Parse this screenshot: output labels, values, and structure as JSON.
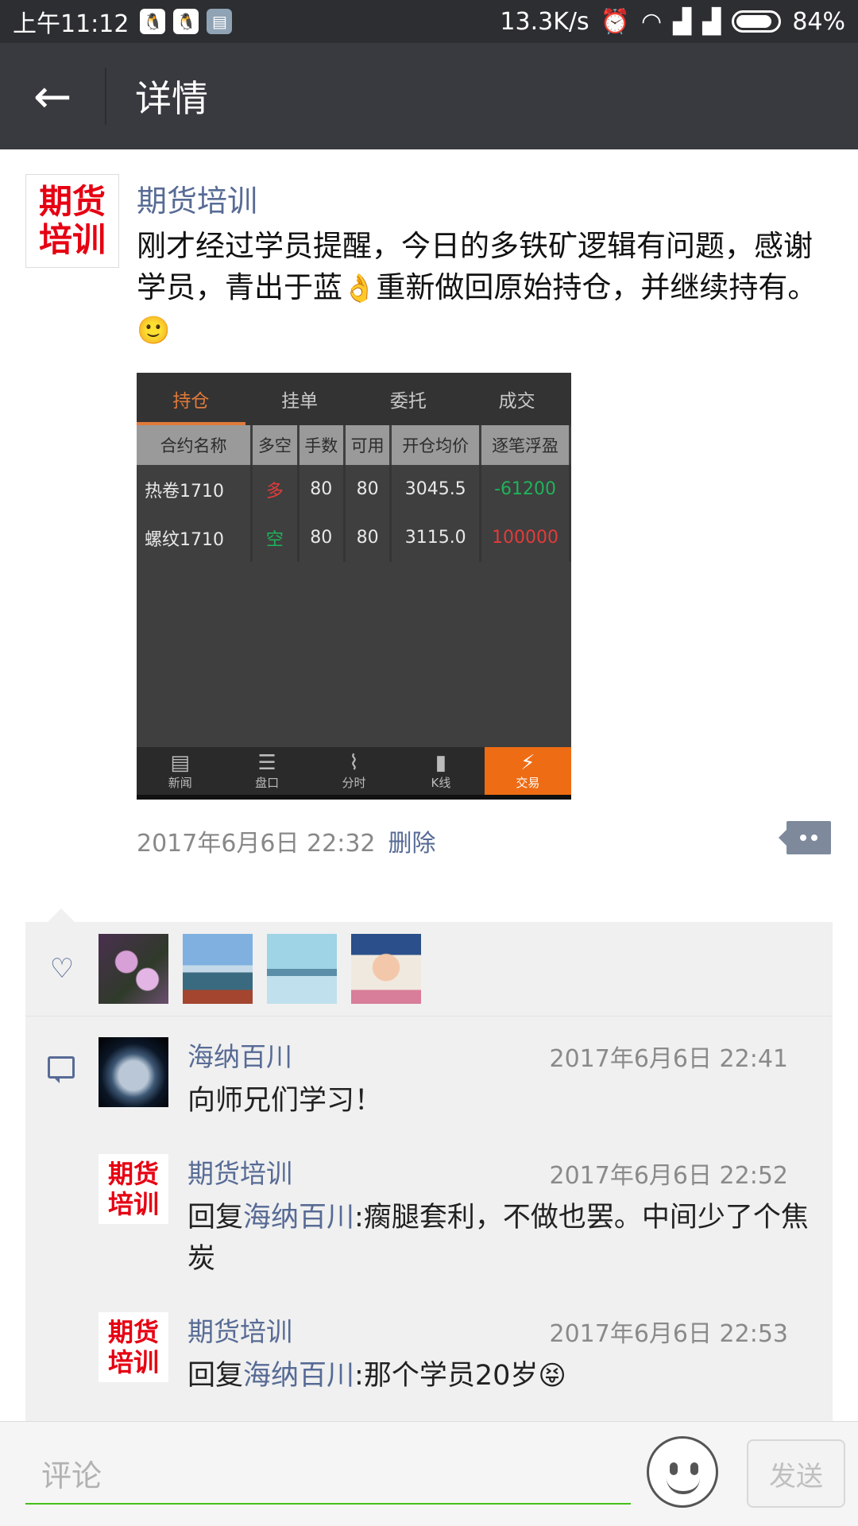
{
  "status_bar": {
    "time": "上午11:12",
    "net_speed": "13.3K/s",
    "battery": "84%",
    "icons": [
      "qq-icon",
      "qq-icon",
      "document-icon",
      "alarm-icon",
      "wifi-icon",
      "signal-icon",
      "signal-icon",
      "battery-icon"
    ]
  },
  "header": {
    "title": "详情"
  },
  "post": {
    "avatar_text": [
      "期货",
      "培训"
    ],
    "author": "期货培训",
    "text_before_emoji": "刚才经过学员提醒，今日的多铁矿逻辑有问题，感谢学员，青出于蓝",
    "emoji1": "👌",
    "text_after_emoji": "重新做回原始持仓，并继续持有。",
    "emoji2": "🙂",
    "timestamp": "2017年6月6日 22:32",
    "delete_label": "删除"
  },
  "screenshot": {
    "tabs": [
      "持仓",
      "挂单",
      "委托",
      "成交"
    ],
    "headers": [
      "合约名称",
      "多空",
      "手数",
      "可用",
      "开仓均价",
      "逐笔浮盈"
    ],
    "rows": [
      [
        "热卷1710",
        "多",
        "80",
        "80",
        "3045.5",
        "-61200"
      ],
      [
        "螺纹1710",
        "空",
        "80",
        "80",
        "3115.0",
        "100000"
      ]
    ],
    "nav": [
      "新闻",
      "盘口",
      "分时",
      "K线",
      "交易"
    ],
    "colors": {
      "accent": "#e07a3a",
      "active_nav": "#ee6c14",
      "gain": "#e23b3b",
      "loss": "#1fb35a"
    }
  },
  "likes": {
    "avatars": [
      "flower-photo",
      "junk-boat-photo",
      "bridge-photo",
      "child-photo"
    ]
  },
  "comments": [
    {
      "name": "海纳百川",
      "time": "2017年6月6日 22:41",
      "text": "向师兄们学习！",
      "reply_to": ""
    },
    {
      "name": "期货培训",
      "time": "2017年6月6日 22:52",
      "prefix": "回复",
      "reply_to": "海纳百川",
      "text": ":瘸腿套利，不做也罢。中间少了个焦炭"
    },
    {
      "name": "期货培训",
      "time": "2017年6月6日 22:53",
      "prefix": "回复",
      "reply_to": "海纳百川",
      "text": ":那个学员20岁",
      "emoji": "😝"
    }
  ],
  "input": {
    "placeholder": "评论",
    "send_label": "发送"
  },
  "colors": {
    "link": "#576b95",
    "header_bg": "#393a3f",
    "input_underline": "#45c01a"
  }
}
